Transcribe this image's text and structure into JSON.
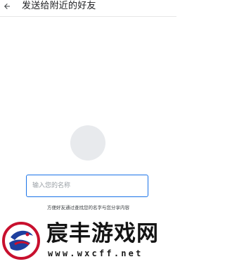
{
  "header": {
    "back_icon": "arrow-left-icon",
    "title": "发送给附近的好友"
  },
  "profile": {
    "avatar_icon": "avatar-placeholder",
    "name_input": {
      "placeholder": "输入您的名称",
      "value": ""
    },
    "hint": "方便好友通过查找您的名字与您分享内容"
  },
  "watermark": {
    "brand": "宸丰游戏网",
    "url": "www.wxcff.net"
  },
  "colors": {
    "accent": "#1a73e8",
    "avatar_bg": "#e8eaed"
  }
}
